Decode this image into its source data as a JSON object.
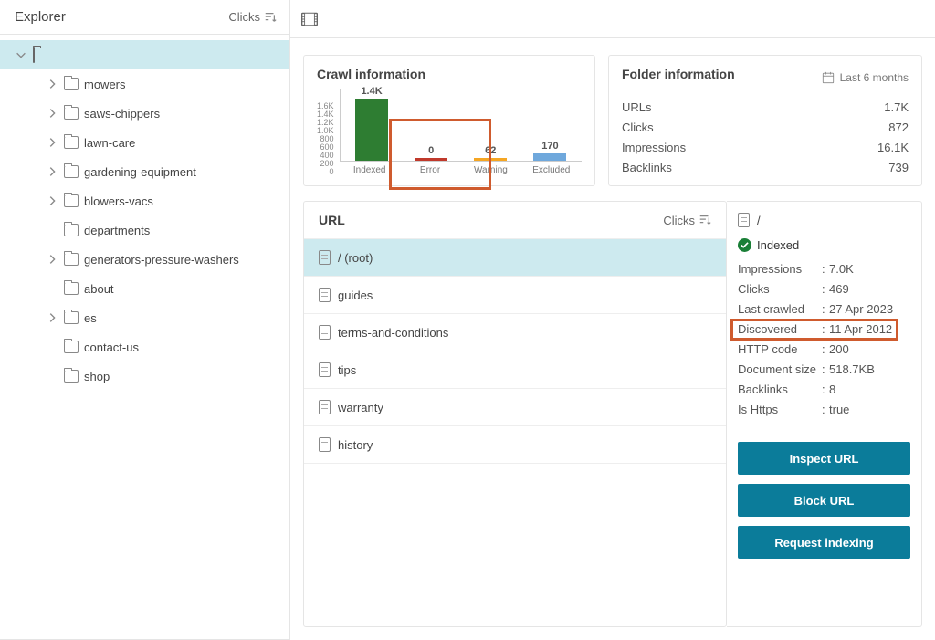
{
  "explorer": {
    "title": "Explorer",
    "sort_label": "Clicks",
    "tree": [
      {
        "label": "mowers",
        "expandable": true
      },
      {
        "label": "saws-chippers",
        "expandable": true
      },
      {
        "label": "lawn-care",
        "expandable": true
      },
      {
        "label": "gardening-equipment",
        "expandable": true
      },
      {
        "label": "blowers-vacs",
        "expandable": true
      },
      {
        "label": "departments",
        "expandable": false
      },
      {
        "label": "generators-pressure-washers",
        "expandable": true
      },
      {
        "label": "about",
        "expandable": false
      },
      {
        "label": "es",
        "expandable": true
      },
      {
        "label": "contact-us",
        "expandable": false
      },
      {
        "label": "shop",
        "expandable": false
      }
    ]
  },
  "crawl_panel": {
    "title": "Crawl information"
  },
  "chart_data": {
    "type": "bar",
    "categories": [
      "Indexed",
      "Error",
      "Warning",
      "Excluded"
    ],
    "values": [
      1400,
      0,
      62,
      170
    ],
    "display_values": [
      "1.4K",
      "0",
      "62",
      "170"
    ],
    "colors": [
      "#2e7d32",
      "#c0392b",
      "#f5a623",
      "#6fa8dc"
    ],
    "y_ticks": [
      "1.6K",
      "1.4K",
      "1.2K",
      "1.0K",
      "800",
      "600",
      "400",
      "200",
      "0"
    ],
    "ylim_max": 1600,
    "title": "Crawl information",
    "xlabel": "",
    "ylabel": ""
  },
  "folder_panel": {
    "title": "Folder information",
    "range_label": "Last 6 months",
    "metrics": [
      {
        "label": "URLs",
        "value": "1.7K"
      },
      {
        "label": "Clicks",
        "value": "872"
      },
      {
        "label": "Impressions",
        "value": "16.1K"
      },
      {
        "label": "Backlinks",
        "value": "739"
      }
    ]
  },
  "url_panel": {
    "title": "URL",
    "sort_label": "Clicks",
    "rows": [
      {
        "label": "/ (root)",
        "selected": true
      },
      {
        "label": "guides",
        "selected": false
      },
      {
        "label": "terms-and-conditions",
        "selected": false
      },
      {
        "label": "tips",
        "selected": false
      },
      {
        "label": "warranty",
        "selected": false
      },
      {
        "label": "history",
        "selected": false
      }
    ]
  },
  "detail_panel": {
    "path": "/",
    "status": "Indexed",
    "kv": [
      {
        "key": "Impressions",
        "value": "7.0K"
      },
      {
        "key": "Clicks",
        "value": "469"
      },
      {
        "key": "Last crawled",
        "value": "27 Apr 2023"
      },
      {
        "key": "Discovered",
        "value": "11 Apr 2012"
      },
      {
        "key": "HTTP code",
        "value": "200"
      },
      {
        "key": "Document size",
        "value": "518.7KB"
      },
      {
        "key": "Backlinks",
        "value": "8"
      },
      {
        "key": "Is Https",
        "value": "true"
      }
    ],
    "buttons": {
      "inspect": "Inspect URL",
      "block": "Block URL",
      "request": "Request indexing"
    }
  }
}
